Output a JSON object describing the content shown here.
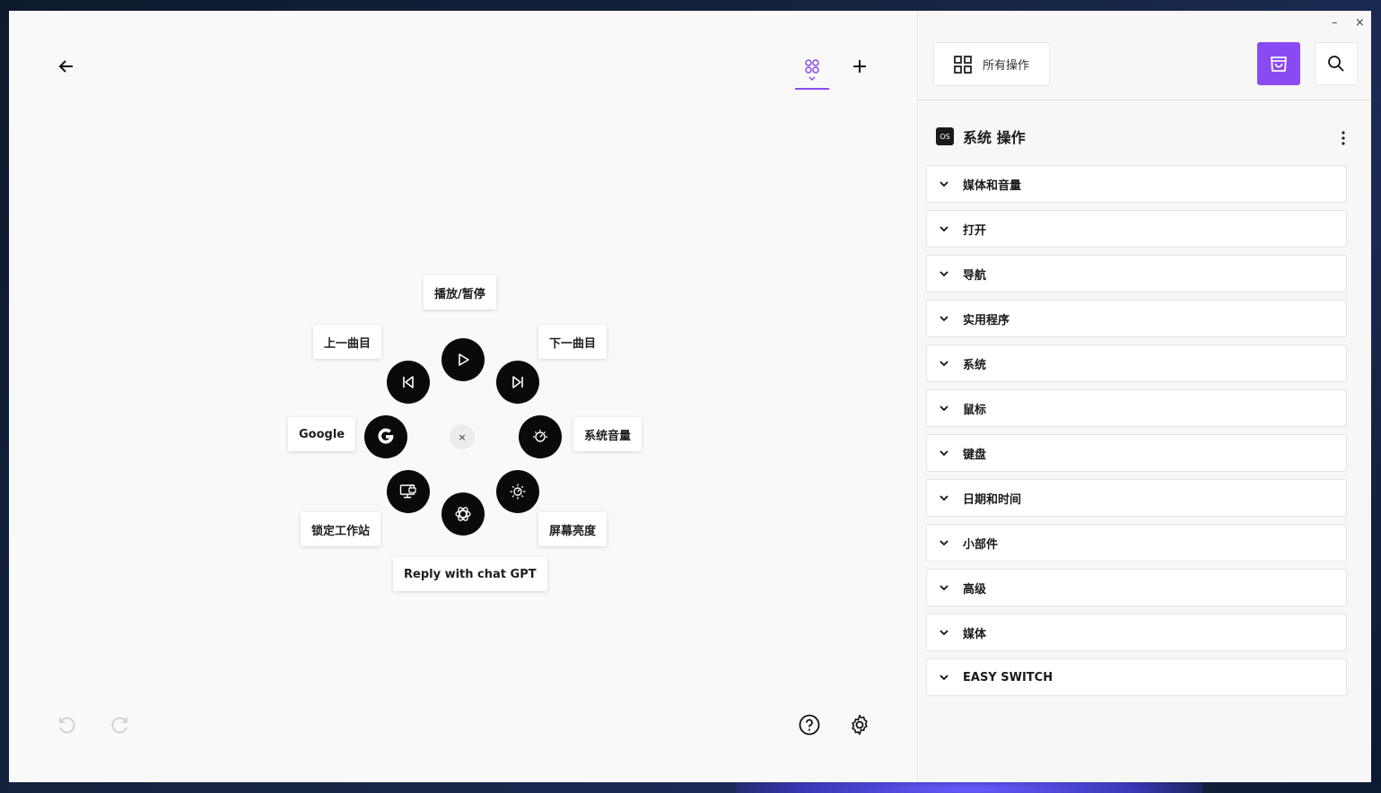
{
  "canvas": {
    "nodes": {
      "play_pause": "播放/暂停",
      "prev_track": "上一曲目",
      "next_track": "下一曲目",
      "google": "Google",
      "system_volume": "系统音量",
      "lock_workstation": "锁定工作站",
      "screen_brightness": "屏幕亮度",
      "reply_chatgpt": "Reply with chat GPT"
    },
    "center_close": "×"
  },
  "panel": {
    "window_controls": {
      "minimize": "–",
      "close": "×"
    },
    "all_actions_label": "所有操作",
    "section_badge": "OS",
    "section_title": "系统 操作",
    "categories": [
      "媒体和音量",
      "打开",
      "导航",
      "实用程序",
      "系统",
      "鼠标",
      "键盘",
      "日期和时间",
      "小部件",
      "高级",
      "媒体",
      "EASY SWITCH"
    ]
  },
  "colors": {
    "accent": "#8a4af3",
    "node_bg": "#0a0a0a",
    "panel_bg": "#f7f7f7"
  },
  "icons": [
    "back-arrow-icon",
    "grid-icon",
    "plus-icon",
    "undo-icon",
    "redo-icon",
    "help-icon",
    "gear-icon",
    "play-icon",
    "skip-previous-icon",
    "skip-next-icon",
    "google-icon",
    "volume-dial-icon",
    "lock-screen-icon",
    "brightness-icon",
    "openai-icon",
    "store-icon",
    "search-icon",
    "kebab-icon",
    "chevron-down-icon"
  ]
}
